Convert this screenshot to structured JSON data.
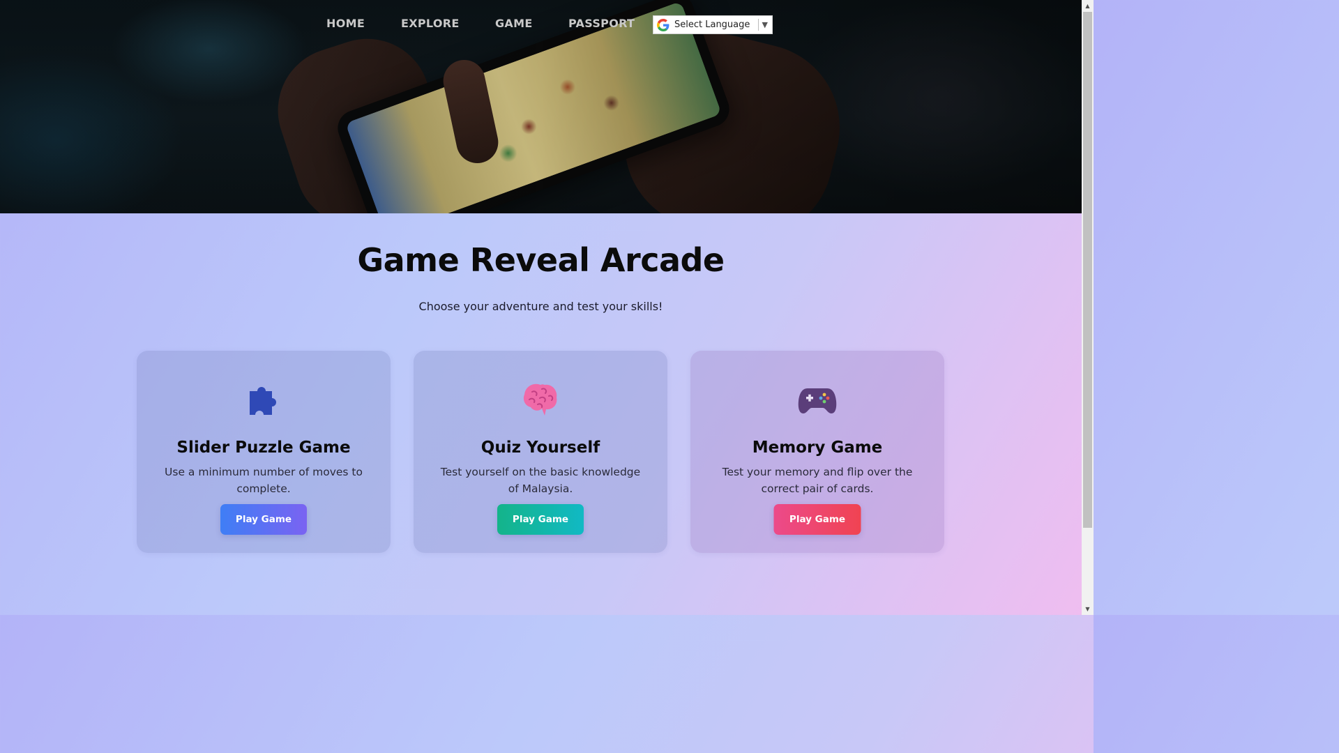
{
  "nav": {
    "items": [
      {
        "label": "HOME"
      },
      {
        "label": "EXPLORE"
      },
      {
        "label": "GAME"
      },
      {
        "label": "PASSPORT"
      }
    ],
    "language": {
      "label": "Select Language",
      "icon": "google-g-icon",
      "caret": "▼"
    }
  },
  "hero": {
    "image": "hands-holding-phone-playing-game"
  },
  "main": {
    "title": "Game Reveal Arcade",
    "subtitle": "Choose your adventure and test your skills!"
  },
  "cards": [
    {
      "icon": "puzzle-piece-icon",
      "title": "Slider Puzzle Game",
      "description": "Use a minimum number of moves to complete.",
      "button_label": "Play Game",
      "button_colors": [
        "#3f7ef5",
        "#7a63f2"
      ]
    },
    {
      "icon": "brain-icon",
      "title": "Quiz Yourself",
      "description": "Test yourself on the basic knowledge of Malaysia.",
      "button_label": "Play Game",
      "button_colors": [
        "#14b48a",
        "#11b9c4"
      ]
    },
    {
      "icon": "game-controller-icon",
      "title": "Memory Game",
      "description": "Test your memory and flip over the correct pair of cards.",
      "button_label": "Play Game",
      "button_colors": [
        "#ec4a8a",
        "#f04352"
      ]
    }
  ],
  "colors": {
    "background_start": "#b3b3f8",
    "background_end": "#f0bdf0",
    "title_text": "#0b0b0b"
  },
  "scrollbar": {
    "up_arrow": "▲",
    "down_arrow": "▼"
  }
}
